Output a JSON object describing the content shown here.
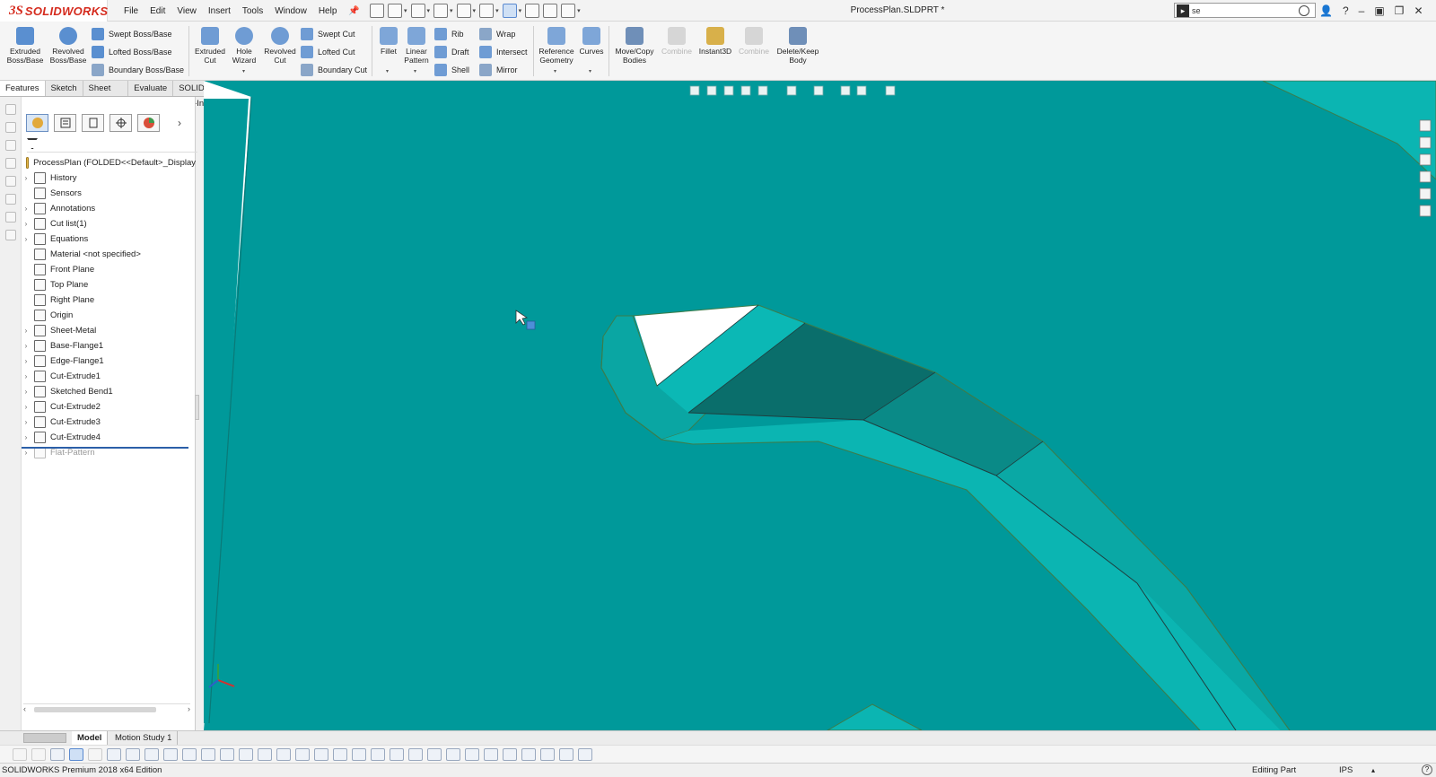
{
  "app": {
    "logo_ds": "3S",
    "logo_text": "SOLIDWORKS",
    "document_title": "ProcessPlan.SLDPRT *",
    "search_value": "se"
  },
  "menu": [
    "File",
    "Edit",
    "View",
    "Insert",
    "Tools",
    "Window",
    "Help"
  ],
  "command_manager": {
    "extruded_boss": "Extruded Boss/Base",
    "revolved_boss": "Revolved Boss/Base",
    "swept_boss": "Swept Boss/Base",
    "lofted_boss": "Lofted Boss/Base",
    "boundary_boss": "Boundary Boss/Base",
    "extruded_cut": "Extruded Cut",
    "hole_wizard": "Hole Wizard",
    "revolved_cut": "Revolved Cut",
    "swept_cut": "Swept Cut",
    "lofted_cut": "Lofted Cut",
    "boundary_cut": "Boundary Cut",
    "fillet": "Fillet",
    "linear_pattern": "Linear Pattern",
    "rib": "Rib",
    "draft": "Draft",
    "shell": "Shell",
    "wrap": "Wrap",
    "intersect": "Intersect",
    "mirror": "Mirror",
    "reference_geometry": "Reference Geometry",
    "curves": "Curves",
    "move_copy_bodies": "Move/Copy Bodies",
    "combine_1": "Combine",
    "instant3d": "Instant3D",
    "combine_2": "Combine",
    "delete_keep_body": "Delete/Keep Body"
  },
  "tabs": [
    "Features",
    "Sketch",
    "Sheet Metal",
    "Evaluate",
    "SOLIDWORKS Add-Ins"
  ],
  "feature_tree": {
    "root": "ProcessPlan  (FOLDED<<Default>_Display",
    "items": [
      {
        "label": "History",
        "expandable": true
      },
      {
        "label": "Sensors",
        "expandable": false
      },
      {
        "label": "Annotations",
        "expandable": true
      },
      {
        "label": "Cut list(1)",
        "expandable": true
      },
      {
        "label": "Equations",
        "expandable": true
      },
      {
        "label": "Material <not specified>",
        "expandable": false
      },
      {
        "label": "Front Plane",
        "expandable": false
      },
      {
        "label": "Top Plane",
        "expandable": false
      },
      {
        "label": "Right Plane",
        "expandable": false
      },
      {
        "label": "Origin",
        "expandable": false
      },
      {
        "label": "Sheet-Metal",
        "expandable": true
      },
      {
        "label": "Base-Flange1",
        "expandable": true
      },
      {
        "label": "Edge-Flange1",
        "expandable": true
      },
      {
        "label": "Cut-Extrude1",
        "expandable": true
      },
      {
        "label": "Sketched Bend1",
        "expandable": true
      },
      {
        "label": "Cut-Extrude2",
        "expandable": true
      },
      {
        "label": "Cut-Extrude3",
        "expandable": true
      },
      {
        "label": "Cut-Extrude4",
        "expandable": true
      },
      {
        "label": "Flat-Pattern",
        "expandable": true,
        "suppressed": true
      }
    ]
  },
  "bottom_tabs": {
    "model": "Model",
    "motion": "Motion Study 1"
  },
  "status": {
    "edition": "SOLIDWORKS Premium 2018 x64 Edition",
    "mode": "Editing Part",
    "units": "IPS"
  },
  "colors": {
    "viewport": "#00999a",
    "part_face_dark": "#0a6b68",
    "part_face_light": "#0bb5b2",
    "hole": "#ffffff"
  }
}
